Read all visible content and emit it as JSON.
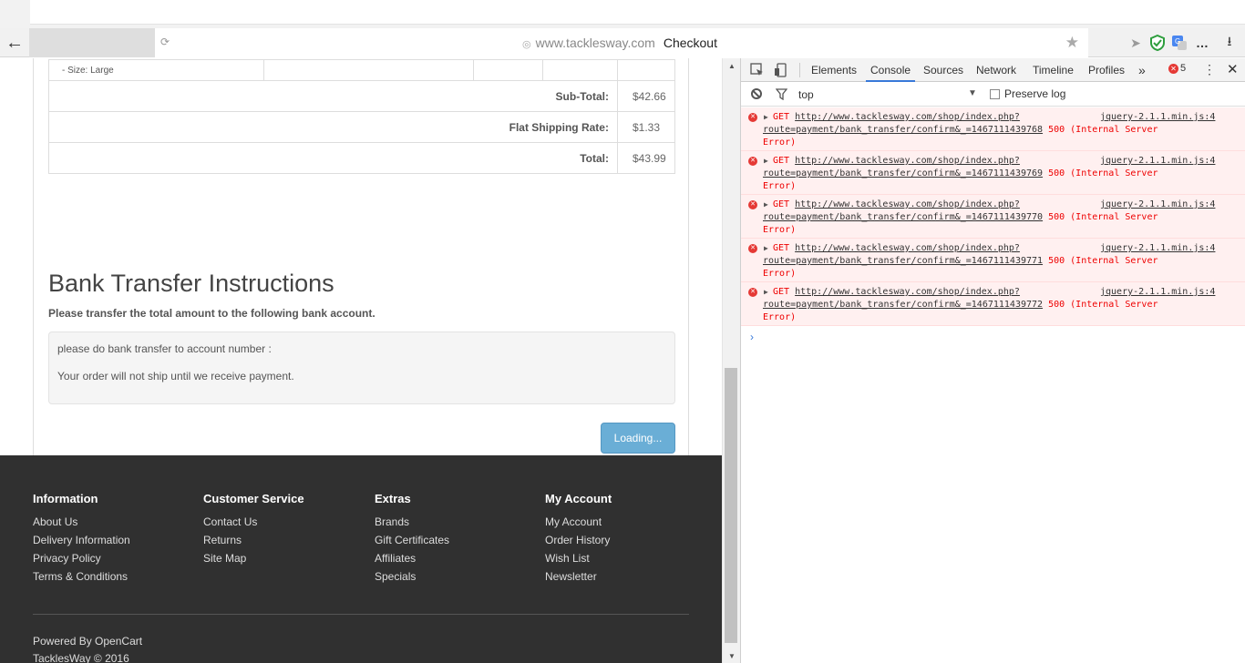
{
  "browser": {
    "url_host": "www.tacklesway.com",
    "page_title": "Checkout",
    "back_icon": "arrow-left-icon",
    "reload_icon": "reload-icon"
  },
  "order": {
    "item_option": "- Size: Large",
    "totals": [
      {
        "label": "Sub-Total:",
        "value": "$42.66"
      },
      {
        "label": "Flat Shipping Rate:",
        "value": "$1.33"
      },
      {
        "label": "Total:",
        "value": "$43.99"
      }
    ]
  },
  "bank": {
    "heading": "Bank Transfer Instructions",
    "subheading": "Please transfer the total amount to the following bank account.",
    "line1": "please do bank transfer to account number :",
    "line2": "Your order will not ship until we receive payment.",
    "button_label": "Loading..."
  },
  "footer": {
    "columns": [
      {
        "title": "Information",
        "links": [
          "About Us",
          "Delivery Information",
          "Privacy Policy",
          "Terms & Conditions"
        ]
      },
      {
        "title": "Customer Service",
        "links": [
          "Contact Us",
          "Returns",
          "Site Map"
        ]
      },
      {
        "title": "Extras",
        "links": [
          "Brands",
          "Gift Certificates",
          "Affiliates",
          "Specials"
        ]
      },
      {
        "title": "My Account",
        "links": [
          "My Account",
          "Order History",
          "Wish List",
          "Newsletter"
        ]
      }
    ],
    "powered_prefix": "Powered By",
    "powered_link": "OpenCart",
    "copyright": "TacklesWay © 2016"
  },
  "devtools": {
    "tabs": [
      "Elements",
      "Console",
      "Sources",
      "Network",
      "Timeline",
      "Profiles"
    ],
    "active_tab": "Console",
    "more_tabs": "»",
    "error_count": "5",
    "context": "top",
    "preserve_log": "Preserve log",
    "messages": [
      {
        "method": "GET",
        "url_part1": "http://www.tacklesway.com/shop/index.php?",
        "url_part2": "route=payment/bank_transfer/confirm&_=1467111439768",
        "status": "500 (Internal Server",
        "status_end": "Error)",
        "source": "jquery-2.1.1.min.js:4"
      },
      {
        "method": "GET",
        "url_part1": "http://www.tacklesway.com/shop/index.php?",
        "url_part2": "route=payment/bank_transfer/confirm&_=1467111439769",
        "status": "500 (Internal Server",
        "status_end": "Error)",
        "source": "jquery-2.1.1.min.js:4"
      },
      {
        "method": "GET",
        "url_part1": "http://www.tacklesway.com/shop/index.php?",
        "url_part2": "route=payment/bank_transfer/confirm&_=1467111439770",
        "status": "500 (Internal Server",
        "status_end": "Error)",
        "source": "jquery-2.1.1.min.js:4"
      },
      {
        "method": "GET",
        "url_part1": "http://www.tacklesway.com/shop/index.php?",
        "url_part2": "route=payment/bank_transfer/confirm&_=1467111439771",
        "status": "500 (Internal Server",
        "status_end": "Error)",
        "source": "jquery-2.1.1.min.js:4"
      },
      {
        "method": "GET",
        "url_part1": "http://www.tacklesway.com/shop/index.php?",
        "url_part2": "route=payment/bank_transfer/confirm&_=1467111439772",
        "status": "500 (Internal Server",
        "status_end": "Error)",
        "source": "jquery-2.1.1.min.js:4"
      }
    ]
  }
}
